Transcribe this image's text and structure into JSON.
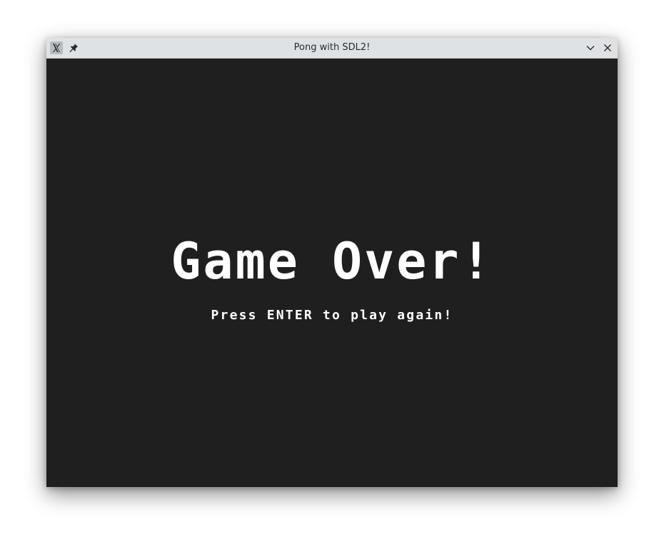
{
  "window": {
    "title": "Pong with SDL2!"
  },
  "titlebar": {
    "app_icon": "x-app-icon",
    "pin_icon": "pin-icon",
    "minimize_icon": "chevron-down-icon",
    "close_icon": "close-icon"
  },
  "game": {
    "headline": "Game Over!",
    "prompt": "Press ENTER to play again!",
    "background_color": "#1f1f1f",
    "text_color": "#ffffff"
  }
}
